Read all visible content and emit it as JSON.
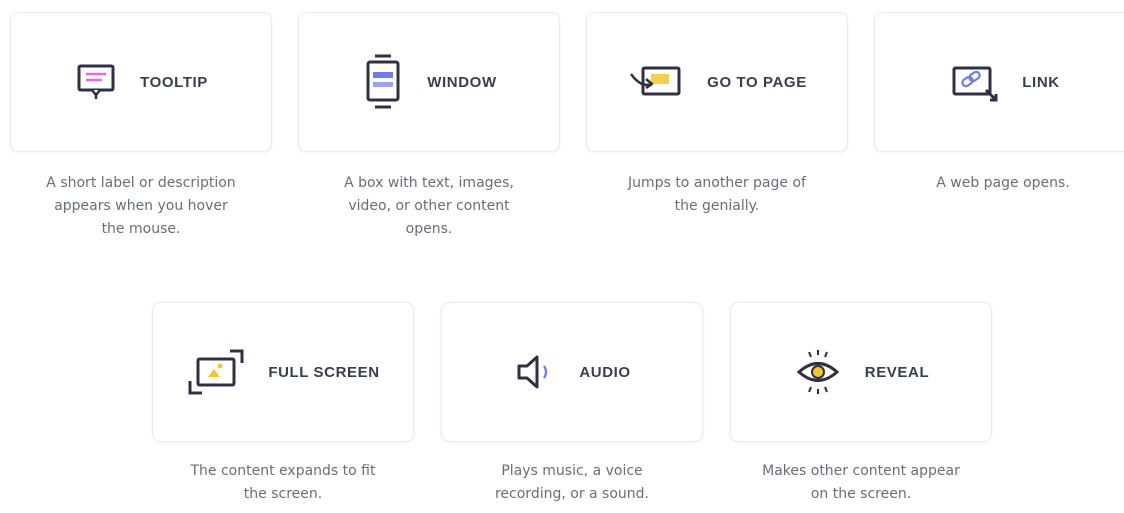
{
  "colors": {
    "icon_dark": "#2f3142",
    "accent_pink": "#e96ad6",
    "accent_blue": "#6f7ce6",
    "accent_yellow": "#f4c431",
    "title_text": "#3b3d4d",
    "desc_text": "#6a6c78"
  },
  "cards": [
    {
      "title": "TOOLTIP",
      "icon": "tooltip-icon",
      "desc_lines": [
        "A short label or description",
        "appears when you hover",
        "the mouse."
      ]
    },
    {
      "title": "WINDOW",
      "icon": "window-icon",
      "desc_lines": [
        "A box with text, images,",
        "video, or other content",
        "opens."
      ]
    },
    {
      "title": "GO TO PAGE",
      "icon": "go-to-page-icon",
      "desc_lines": [
        "Jumps to another page of",
        "the genially."
      ]
    },
    {
      "title": "LINK",
      "icon": "link-icon",
      "desc_lines": [
        "A web page opens."
      ]
    },
    {
      "title": "FULL SCREEN",
      "icon": "full-screen-icon",
      "desc_lines": [
        "The content expands to fit",
        "the screen."
      ]
    },
    {
      "title": "AUDIO",
      "icon": "audio-icon",
      "desc_lines": [
        "Plays music, a voice",
        "recording, or a sound."
      ]
    },
    {
      "title": "REVEAL",
      "icon": "reveal-icon",
      "desc_lines": [
        "Makes other content appear",
        "on the screen."
      ]
    }
  ]
}
